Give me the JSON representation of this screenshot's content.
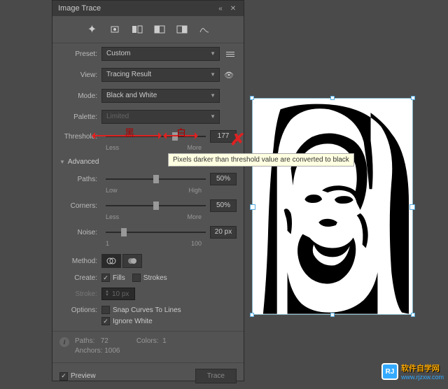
{
  "panel": {
    "title": "Image Trace",
    "preset": {
      "label": "Preset:",
      "value": "Custom"
    },
    "view": {
      "label": "View:",
      "value": "Tracing Result"
    },
    "mode": {
      "label": "Mode:",
      "value": "Black and White"
    },
    "palette": {
      "label": "Palette:",
      "value": "Limited"
    },
    "threshold": {
      "label": "Threshold:",
      "value": "177",
      "lo": "Less",
      "hi": "More"
    },
    "advanced": "Advanced",
    "paths": {
      "label": "Paths:",
      "value": "50%",
      "lo": "Low",
      "hi": "High"
    },
    "corners": {
      "label": "Corners:",
      "value": "50%",
      "lo": "Less",
      "hi": "More"
    },
    "noise": {
      "label": "Noise:",
      "value": "20 px",
      "lo": "1",
      "hi": "100"
    },
    "method": {
      "label": "Method:"
    },
    "create": {
      "label": "Create:",
      "fills": "Fills",
      "strokes": "Strokes"
    },
    "stroke": {
      "label": "Stroke:",
      "value": "10 px"
    },
    "options": {
      "label": "Options:",
      "snap": "Snap Curves To Lines",
      "ignore": "Ignore White"
    },
    "info": {
      "paths_label": "Paths:",
      "paths_val": "72",
      "colors_label": "Colors:",
      "colors_val": "1",
      "anchors_label": "Anchors:",
      "anchors_val": "1006"
    },
    "preview": "Preview",
    "trace": "Trace"
  },
  "tooltip": "Pixels darker than threshold value are converted to black",
  "anno": {
    "black": "黑",
    "white": "白"
  },
  "watermark": {
    "text": "软件自学网",
    "url": "www.rjzxw.com"
  }
}
